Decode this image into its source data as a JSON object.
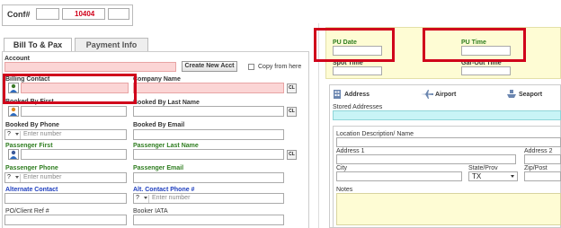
{
  "header": {
    "conf_label": "Conf#",
    "conf_number": "10404"
  },
  "tabs": [
    {
      "label": "Bill To & Pax"
    },
    {
      "label": "Payment Info"
    }
  ],
  "left": {
    "account_label": "Account",
    "create_account_label": "Create New Acct",
    "copy_from_here_label": "Copy from here",
    "billing_contact_label": "Billing Contact",
    "company_name_label": "Company Name",
    "cl_label": "CL",
    "booked_by_first_label": "Booked By First",
    "booked_by_last_label": "Booked By Last Name",
    "booked_by_phone_label": "Booked By Phone",
    "booked_by_email_label": "Booked By Email",
    "passenger_first_label": "Passenger First",
    "passenger_last_label": "Passenger Last Name",
    "passenger_phone_label": "Passenger Phone",
    "passenger_email_label": "Passenger Email",
    "alternate_contact_label": "Alternate Contact",
    "alt_contact_phone_label": "Alt. Contact Phone #",
    "po_client_ref_label": "PO/Client Ref #",
    "booker_iata_label": "Booker IATA",
    "phone_country_code": "?",
    "phone_placeholder": "Enter number"
  },
  "right": {
    "pu_date_label": "PU Date",
    "pu_time_label": "PU Time",
    "spot_time_label": "Spot Time",
    "gar_out_time_label": "Gar-Out Time",
    "location_tabs": [
      {
        "label": "Address",
        "icon": "building-icon"
      },
      {
        "label": "Airport",
        "icon": "airplane-icon"
      },
      {
        "label": "Seaport",
        "icon": "ship-icon"
      }
    ],
    "stored_addresses_label": "Stored Addresses",
    "location_description_label": "Location Description/ Name",
    "address1_label": "Address 1",
    "address2_label": "Address 2",
    "city_label": "City",
    "state_label": "State/Prov",
    "state_value": "TX",
    "zip_label": "Zip/Post",
    "notes_label": "Notes"
  },
  "colors": {
    "highlight_red": "#d0021b",
    "required_pink": "#fbd5d5",
    "green_label": "#2e7d1f",
    "blue_label": "#1f3fbf"
  }
}
